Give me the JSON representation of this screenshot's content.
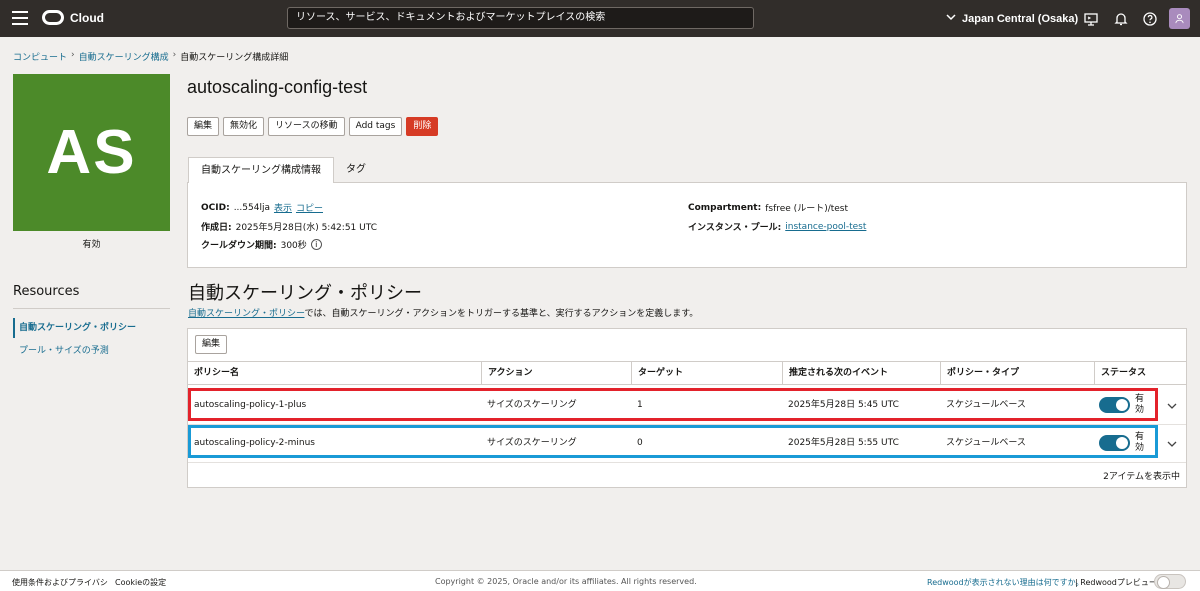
{
  "topbar": {
    "logo_text": "Cloud",
    "search_placeholder": "リソース、サービス、ドキュメントおよびマーケットプレイスの検索",
    "region": "Japan Central (Osaka)"
  },
  "breadcrumb": {
    "items": [
      "コンピュート",
      "自動スケーリング構成",
      "自動スケーリング構成詳細"
    ]
  },
  "resource": {
    "initials": "AS",
    "status": "有効",
    "title": "autoscaling-config-test"
  },
  "actions": {
    "edit": "編集",
    "disable": "無効化",
    "move": "リソースの移動",
    "add_tags": "Add tags",
    "delete": "削除"
  },
  "tabs": {
    "info": "自動スケーリング構成情報",
    "tags": "タグ"
  },
  "info": {
    "ocid_label": "OCID:",
    "ocid_value": "...554lja",
    "show": "表示",
    "copy": "コピー",
    "created_label": "作成日:",
    "created_value": "2025年5月28日(水) 5:42:51 UTC",
    "cooldown_label": "クールダウン期間:",
    "cooldown_value": "300秒",
    "compartment_label": "Compartment:",
    "compartment_value": "fsfree (ルート)/test",
    "pool_label": "インスタンス・プール:",
    "pool_value": "instance-pool-test"
  },
  "sidebar": {
    "title": "Resources",
    "items": [
      "自動スケーリング・ポリシー",
      "プール・サイズの予測"
    ]
  },
  "policies": {
    "title": "自動スケーリング・ポリシー",
    "desc_link": "自動スケーリング・ポリシー",
    "desc_rest": "では、自動スケーリング・アクションをトリガーする基準と、実行するアクションを定義します。",
    "edit": "編集",
    "columns": [
      "ポリシー名",
      "アクション",
      "ターゲット",
      "推定される次のイベント",
      "ポリシー・タイプ",
      "ステータス"
    ],
    "rows": [
      {
        "name": "autoscaling-policy-1-plus",
        "action": "サイズのスケーリング",
        "target": "1",
        "next": "2025年5月28日 5:45 UTC",
        "type": "スケジュールベース",
        "status": "有効"
      },
      {
        "name": "autoscaling-policy-2-minus",
        "action": "サイズのスケーリング",
        "target": "0",
        "next": "2025年5月28日 5:55 UTC",
        "type": "スケジュールベース",
        "status": "有効"
      }
    ],
    "footer": "2アイテムを表示中"
  },
  "footer": {
    "terms": "使用条件およびプライバシ",
    "cookies": "Cookieの設定",
    "copyright": "Copyright © 2025, Oracle and/or its affiliates. All rights reserved.",
    "redwood_link": "Redwoodが表示されない理由は何ですか。",
    "redwood_preview": "| Redwoodプレビュー"
  },
  "colors": {
    "topbar": "#312d2a",
    "tile": "#4c8a29",
    "link": "#176c8f",
    "danger": "#d63b25",
    "highlight_red": "#e3222b",
    "highlight_blue": "#199ad6"
  }
}
